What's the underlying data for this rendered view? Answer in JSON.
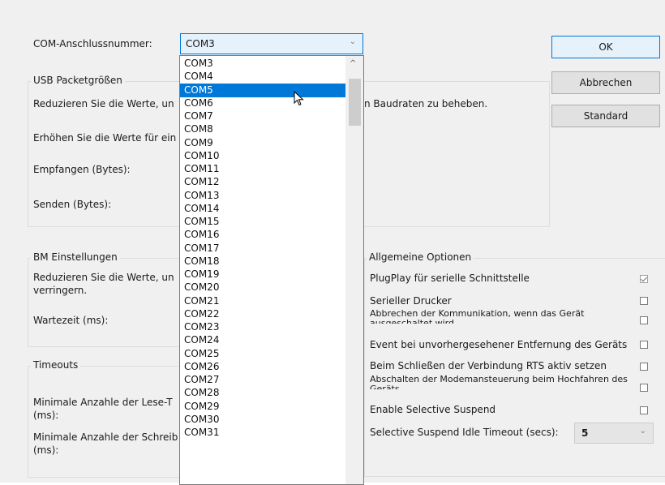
{
  "com": {
    "label": "COM-Anschlussnummer:",
    "selected": "COM3",
    "options": [
      "COM3",
      "COM4",
      "COM5",
      "COM6",
      "COM7",
      "COM8",
      "COM9",
      "COM10",
      "COM11",
      "COM12",
      "COM13",
      "COM14",
      "COM15",
      "COM16",
      "COM17",
      "COM18",
      "COM19",
      "COM20",
      "COM21",
      "COM22",
      "COM23",
      "COM24",
      "COM25",
      "COM26",
      "COM27",
      "COM28",
      "COM29",
      "COM30",
      "COM31"
    ],
    "highlighted": "COM5"
  },
  "buttons": {
    "ok": "OK",
    "cancel": "Abbrechen",
    "defaults": "Standard"
  },
  "usb": {
    "title": "USB Packetgrößen",
    "desc1_left": "Reduzieren Sie die Werte, un",
    "desc1_right": "n Baudraten zu beheben.",
    "desc2": "Erhöhen Sie die Werte für ein",
    "receive": "Empfangen (Bytes):",
    "send": "Senden (Bytes):"
  },
  "bm": {
    "title": "BM Einstellungen",
    "desc_line1": "Reduzieren Sie die Werte, un",
    "desc_line2": "verringern.",
    "latency": "Wartezeit (ms):"
  },
  "timeouts": {
    "title": "Timeouts",
    "read_line1": "Minimale Anzahle der Lese-T",
    "read_line2": "(ms):",
    "write_line1": "Minimale Anzahle der Schreib",
    "write_line2": "(ms):"
  },
  "general": {
    "title": "Allgemeine Optionen",
    "options": [
      {
        "label": "PlugPlay für serielle Schnittstelle",
        "checked": true
      },
      {
        "label": "Serieller Drucker",
        "checked": false
      },
      {
        "label": "Abbrechen der Kommunikation, wenn das Gerät ausgeschaltet wird",
        "checked": false
      },
      {
        "label": "Event bei unvorhergesehener Entfernung des Geräts",
        "checked": false
      },
      {
        "label": "Beim Schließen der Verbindung RTS aktiv setzen",
        "checked": false
      },
      {
        "label": "Abschalten der Modemansteuerung beim Hochfahren des Geräts",
        "checked": false
      },
      {
        "label": "Enable Selective Suspend",
        "checked": false
      }
    ],
    "idle_label": "Selective Suspend Idle Timeout (secs):",
    "idle_value": "5"
  }
}
